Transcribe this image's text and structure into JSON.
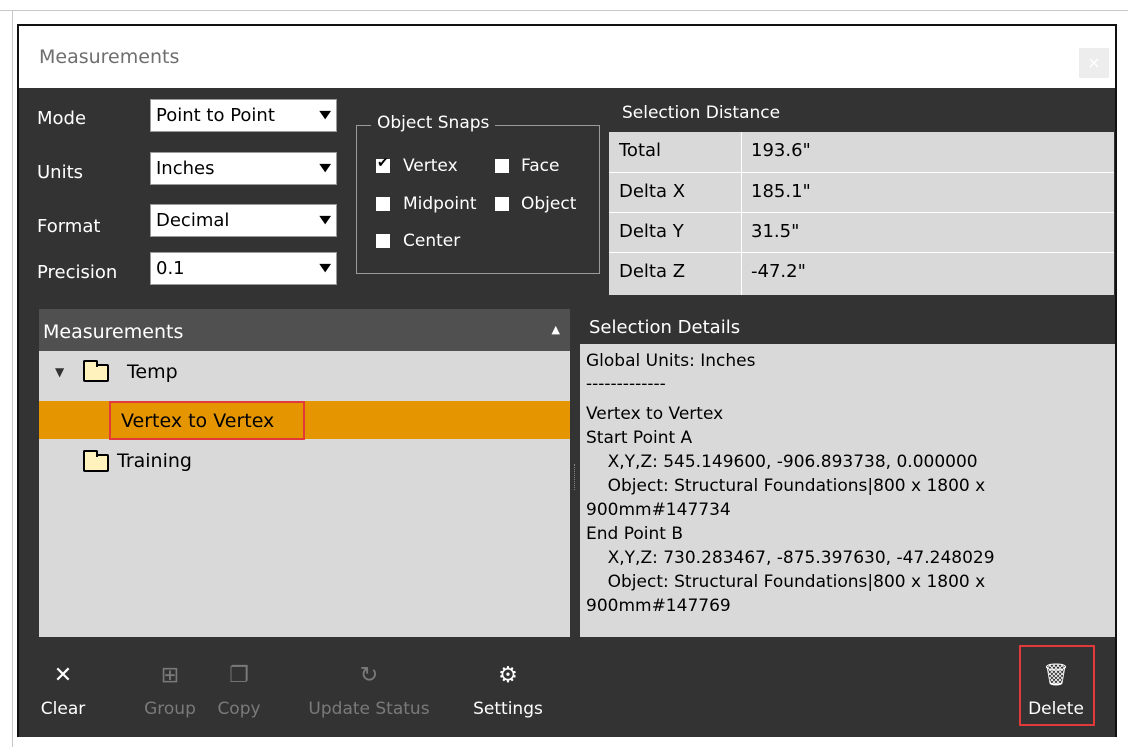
{
  "window": {
    "title": "Measurements",
    "close": "×"
  },
  "settings": {
    "mode": {
      "label": "Mode",
      "value": "Point to Point"
    },
    "units": {
      "label": "Units",
      "value": "Inches"
    },
    "format": {
      "label": "Format",
      "value": "Decimal"
    },
    "precision": {
      "label": "Precision",
      "value": "0.1"
    }
  },
  "snaps": {
    "title": "Object Snaps",
    "vertex": {
      "label": "Vertex",
      "checked": true
    },
    "face": {
      "label": "Face",
      "checked": false
    },
    "midpoint": {
      "label": "Midpoint",
      "checked": false
    },
    "object": {
      "label": "Object",
      "checked": false
    },
    "center": {
      "label": "Center",
      "checked": false
    },
    "check_mark": "✔"
  },
  "selection_distance": {
    "title": "Selection Distance",
    "rows": [
      {
        "label": "Total",
        "value": "193.6\""
      },
      {
        "label": "Delta X",
        "value": "185.1\""
      },
      {
        "label": "Delta Y",
        "value": "31.5\""
      },
      {
        "label": "Delta Z",
        "value": "-47.2\""
      }
    ]
  },
  "measurements": {
    "title": "Measurements",
    "items": [
      {
        "label": "Temp",
        "type": "folder",
        "expanded": true
      },
      {
        "label": "Vertex to Vertex",
        "type": "measurement",
        "selected": true
      },
      {
        "label": "Training",
        "type": "folder"
      }
    ]
  },
  "details": {
    "title": "Selection Details",
    "lines": [
      "Global Units: Inches",
      "-------------",
      "Vertex to Vertex",
      "Start Point A",
      "    X,Y,Z: 545.149600, -906.893738, 0.000000",
      "    Object: Structural Foundations|800 x 1800 x",
      "900mm#147734",
      "End Point B",
      "    X,Y,Z: 730.283467, -875.397630, -47.248029",
      "    Object: Structural Foundations|800 x 1800 x",
      "900mm#147769"
    ]
  },
  "toolbar": {
    "clear": "Clear",
    "group": "Group",
    "copy": "Copy",
    "update_status": "Update Status",
    "settings": "Settings",
    "delete": "Delete"
  },
  "colors": {
    "selected_row": "#e49500",
    "highlight_box": "#e23a3a",
    "panel_bg": "#333333"
  }
}
